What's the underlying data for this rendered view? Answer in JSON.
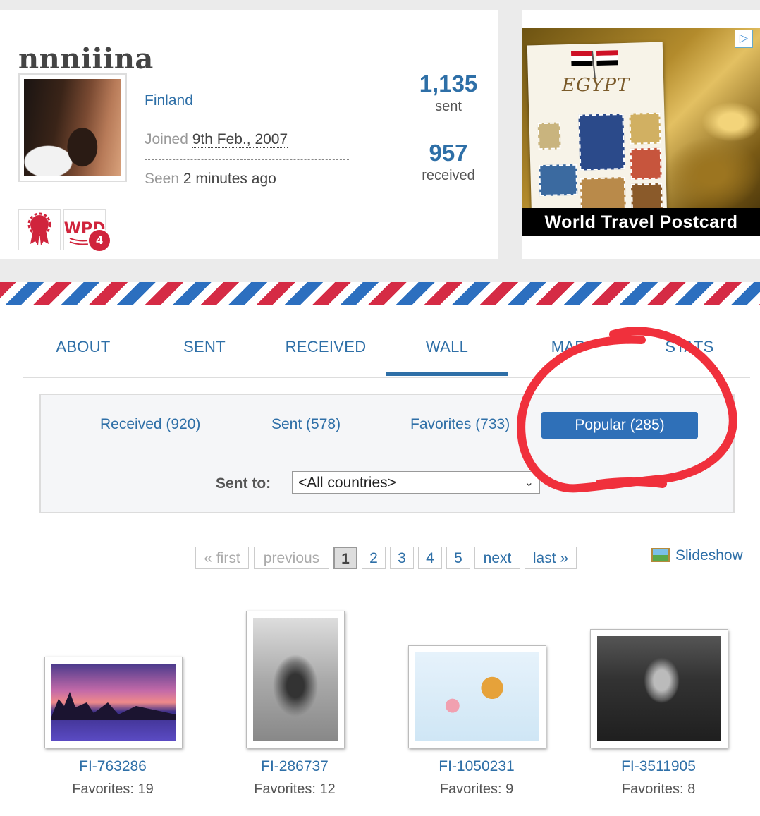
{
  "profile": {
    "username": "nnniiina",
    "country": "Finland",
    "joined_label": "Joined",
    "joined_value": "9th Feb., 2007",
    "seen_label": "Seen",
    "seen_value": "2 minutes ago",
    "sent_count": "1,135",
    "sent_label": "sent",
    "received_count": "957",
    "received_label": "received",
    "badge_wpd_text": "WPD",
    "badge_wpd_count": "4"
  },
  "ad": {
    "caption": "World Travel Postcard",
    "postcard_title": "EGYPT",
    "choice_icon": "ad-choices-icon"
  },
  "tabs": [
    {
      "label": "ABOUT"
    },
    {
      "label": "SENT"
    },
    {
      "label": "RECEIVED"
    },
    {
      "label": "WALL",
      "active": true
    },
    {
      "label": "MAP"
    },
    {
      "label": "STATS"
    }
  ],
  "wall_filters": {
    "received": "Received (920)",
    "sent": "Sent (578)",
    "favorites": "Favorites (733)",
    "popular": "Popular (285)",
    "sent_to_label": "Sent to:",
    "sent_to_value": "<All countries>"
  },
  "pagination": {
    "first": "« first",
    "previous": "previous",
    "pages": [
      "1",
      "2",
      "3",
      "4",
      "5"
    ],
    "current": "1",
    "next": "next",
    "last": "last »",
    "slideshow": "Slideshow"
  },
  "postcards": [
    {
      "id": "FI-763286",
      "favorites": "Favorites: 19"
    },
    {
      "id": "FI-286737",
      "favorites": "Favorites: 12"
    },
    {
      "id": "FI-1050231",
      "favorites": "Favorites: 9"
    },
    {
      "id": "FI-3511905",
      "favorites": "Favorites: 8"
    }
  ],
  "colors": {
    "link": "#2e6fa7",
    "active_button": "#2f70b8",
    "airmail_red": "#d52b45",
    "airmail_blue": "#2c6fbf",
    "annotation_red": "#f0303c"
  }
}
